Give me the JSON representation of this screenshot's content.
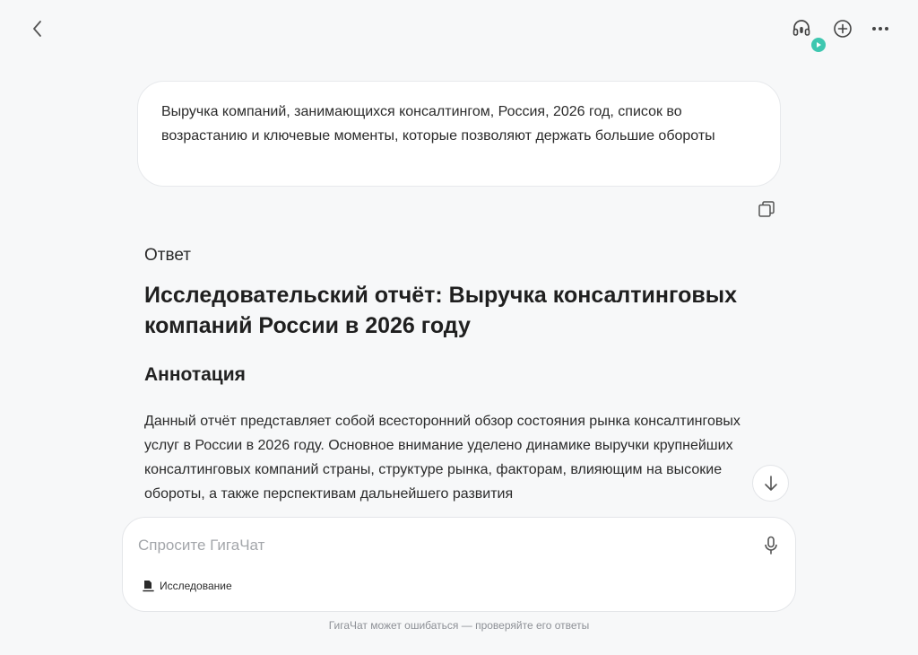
{
  "topbar": {
    "back_icon": "chevron-left-icon",
    "headset_icon": "headset-icon",
    "new_chat_icon": "plus-circle-icon",
    "more_icon": "ellipsis-icon",
    "live_badge_icon": "play-icon",
    "live_badge_color": "#3ec7b0"
  },
  "user_message": {
    "text": "Выручка компаний, занимающихся консалтингом, Россия, 2026 год, список во возрастанию и ключевые моменты, которые позволяют держать большие обороты",
    "copy_icon": "copy-icon"
  },
  "answer": {
    "label": "Ответ",
    "title": "Исследовательский отчёт: Выручка консалтинговых компаний России в 2026 году",
    "section_title": "Аннотация",
    "body": "Данный отчёт представляет собой всесторонний обзор состояния рынка консалтинговых услуг в России в 2026 году. Основное внимание уделено динамике выручки крупнейших консалтинговых компаний страны, структуре рынка, факторам, влияющим на высокие обороты, а также перспективам дальнейшего развития"
  },
  "scroll_down_icon": "arrow-down-icon",
  "composer": {
    "placeholder": "Спросите ГигаЧат",
    "value": "",
    "mic_icon": "microphone-icon",
    "mode_icon": "document-icon",
    "mode_label": "Исследование"
  },
  "footer": {
    "disclaimer": "ГигаЧат может ошибаться — проверяйте его ответы"
  }
}
